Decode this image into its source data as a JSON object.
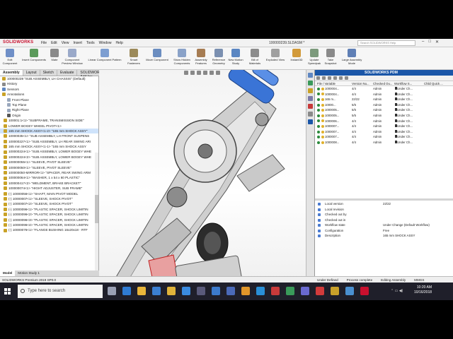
{
  "app": {
    "logo": "SOLIDWORKS",
    "doc_title": "100000239.SLDASM *",
    "search_placeholder": "Search SOLIDWORKS Help",
    "menus": [
      "File",
      "Edit",
      "View",
      "Insert",
      "Tools",
      "Window",
      "Help"
    ],
    "window_controls": [
      "–",
      "□",
      "✕"
    ]
  },
  "commands": [
    {
      "label": "Edit Component",
      "icon": "edit-component-icon",
      "color": "#6f8fc7"
    },
    {
      "label": "Insert Components",
      "icon": "insert-components-icon",
      "color": "#5b9a5b"
    },
    {
      "label": "Mate",
      "icon": "mate-icon",
      "color": "#8a8a8a"
    },
    {
      "label": "Component Preview Window",
      "icon": "preview-window-icon",
      "color": "#9aa9c9"
    },
    {
      "label": "Linear Component Pattern",
      "icon": "linear-pattern-icon",
      "color": "#7d9ed1"
    },
    {
      "label": "Smart Fasteners",
      "icon": "smart-fasteners-icon",
      "color": "#9c8a5a"
    },
    {
      "label": "Move Component",
      "icon": "move-component-icon",
      "color": "#6b8dc0"
    },
    {
      "label": "Show Hidden Components",
      "icon": "show-hidden-icon",
      "color": "#8aa2c8"
    },
    {
      "label": "Assembly Features",
      "icon": "assembly-features-icon",
      "color": "#a67c52"
    },
    {
      "label": "Reference Geometry",
      "icon": "reference-geometry-icon",
      "color": "#7a8fb0"
    },
    {
      "label": "New Motion Study",
      "icon": "motion-study-icon",
      "color": "#5a86c2"
    },
    {
      "label": "Bill of Materials",
      "icon": "bom-icon",
      "color": "#8b8b8b"
    },
    {
      "label": "Exploded View",
      "icon": "exploded-view-icon",
      "color": "#a0a0a0"
    },
    {
      "label": "Instant3D",
      "icon": "instant3d-icon",
      "color": "#d29a3a"
    },
    {
      "label": "Update Speedpak",
      "icon": "speedpak-icon",
      "color": "#7c9a7c"
    },
    {
      "label": "Take Snapshot",
      "icon": "snapshot-icon",
      "color": "#8a8a8a"
    },
    {
      "label": "Large Assembly Mode",
      "icon": "large-assembly-icon",
      "color": "#5f7fb5"
    }
  ],
  "tabs": [
    "Assembly",
    "Layout",
    "Sketch",
    "Evaluate",
    "SOLIDWORKS Add-Ins"
  ],
  "tree": [
    {
      "label": "100000239 \"SUB ASSEMBLY, LH CHASSIS\" (Default)",
      "color": "#c9a227"
    },
    {
      "label": "History",
      "color": "#8a8a8a"
    },
    {
      "label": "Sensors",
      "color": "#5f87c2"
    },
    {
      "label": "Annotations",
      "color": "#c9a227"
    },
    {
      "label": "Front Plane",
      "color": "#9aa8bd"
    },
    {
      "label": "Top Plane",
      "color": "#9aa8bd"
    },
    {
      "label": "Right Plane",
      "color": "#9aa8bd"
    },
    {
      "label": "Origin",
      "color": "#555555"
    },
    {
      "label": "100001:1<1> \"SUBFRAME, TRANSMISSION SIDE\"",
      "color": "#c9a227"
    },
    {
      "label": "LOWER BOGEY WHEEL PIVOT<1>",
      "color": "#c9a227"
    },
    {
      "label": "165 mm SHOCK ASSY<1-2> \"165 mm SHOCK ASSY\"",
      "color": "#c9a227",
      "selected": true
    },
    {
      "label": "10000035<1> \"SUB ASSEMBLY, LH FRONT SUSPENS",
      "color": "#c9a227"
    },
    {
      "label": "100000227<1> \"SUB ASSEMBLY, LH REAR SWING ARI",
      "color": "#c9a227"
    },
    {
      "label": "165 mm SHOCK ASSY<1-1> \"165 mm SHOCK ASSY",
      "color": "#c9a227"
    },
    {
      "label": "100000224<1> \"SUB ASSEMBLY, LOWER BOGEY WHE",
      "color": "#c9a227"
    },
    {
      "label": "100000224<2> \"SUB ASSEMBLY, LOWER BOGEY WHE",
      "color": "#c9a227"
    },
    {
      "label": "100000055<1> \"SLEEVE, PIVOT SLEEVE\"",
      "color": "#c9a227"
    },
    {
      "label": "100000050<1> \"SLEEVE, PIVOT SLEEVE\"",
      "color": "#c9a227"
    },
    {
      "label": "100000050-MIRROR<1> \"SPACER, REAR SWING ARM",
      "color": "#c9a227"
    },
    {
      "label": "100000064<1> \"WASHER, 1 x 54 x 60 PLASTIC\"",
      "color": "#c9a227"
    },
    {
      "label": "100000417<2> \"WELDMENT, BRAKE BRACKET\"",
      "color": "#c9a227"
    },
    {
      "label": "100000074<1> \"HIGHT ADJUSTER, SUB FRAME\"",
      "color": "#c9a227"
    },
    {
      "label": "(-) 10000056<1> \"SHAFT, MAIN PIVOT MODEL",
      "color": "#c9a227"
    },
    {
      "label": "(-) 10000007<1> \"SLEEVE, SHOCK PIVOT\"",
      "color": "#c9a227"
    },
    {
      "label": "(-) 10000007<2> \"SLEEVE, SHOCK PIVOT\"",
      "color": "#c9a227"
    },
    {
      "label": "(-) 10000096<1> \"PLASTIC SPACER, SHOCK LIMITIN",
      "color": "#c9a227"
    },
    {
      "label": "(-) 10000096<2> \"PLASTIC SPACER, SHOCK LIMITIN",
      "color": "#c9a227"
    },
    {
      "label": "(-) 10000096<3> \"PLASTIC SPACER, SHOCK LIMITIN",
      "color": "#c9a227"
    },
    {
      "label": "(-) 10000096<4> \"PLASTIC SPACER, SHOCK LIMITIN",
      "color": "#c9a227"
    },
    {
      "label": "(-) 10000076<1> \"FLANGE BUSHING 16x20x18 - RTF",
      "color": "#c9a227"
    }
  ],
  "bottom_tabs": [
    "Model",
    "Motion Study 1"
  ],
  "status": {
    "left": "SOLIDWORKS Premium 2019 SP0.0",
    "items": [
      "Under Defined",
      "Process complete",
      "Editing Assembly",
      "MMGS"
    ]
  },
  "pdm": {
    "title": "SOLIDWORKS PDM",
    "columns": [
      "File / Variable",
      "Version Nu...",
      "Checked Ou...",
      "Workflow S...",
      "Child Quick ..."
    ],
    "rows": [
      {
        "file": "1000004...",
        "version": "4/4",
        "checked": "Admin",
        "workflow": "Under Ch..."
      },
      {
        "file": "1000004...",
        "version": "4/4",
        "checked": "Admin",
        "workflow": "Under Ch..."
      },
      {
        "file": "165 m...",
        "version": "22/22",
        "checked": "Admin",
        "workflow": "Under Ch..."
      },
      {
        "file": "10000...",
        "version": "5/5",
        "checked": "Admin",
        "workflow": "Under Ch..."
      },
      {
        "file": "1000005...",
        "version": "5/5",
        "checked": "Admin",
        "workflow": "Under Ch..."
      },
      {
        "file": "1000005...",
        "version": "5/5",
        "checked": "Admin",
        "workflow": "Under Ch..."
      },
      {
        "file": "1000006...",
        "version": "4/4",
        "checked": "Admin",
        "workflow": "Under Ch..."
      },
      {
        "file": "1000007...",
        "version": "4/4",
        "checked": "Admin",
        "workflow": "Under Ch..."
      },
      {
        "file": "1000007...",
        "version": "4/4",
        "checked": "Admin",
        "workflow": "Under Ch..."
      },
      {
        "file": "1000007...",
        "version": "4/4",
        "checked": "Admin",
        "workflow": "Under Ch..."
      },
      {
        "file": "1000008...",
        "version": "4/4",
        "checked": "Admin",
        "workflow": "Under Ch..."
      }
    ],
    "details": [
      {
        "key": "Local version",
        "value": "22/22"
      },
      {
        "key": "Local revision",
        "value": ""
      },
      {
        "key": "Checked out by",
        "value": ""
      },
      {
        "key": "Checked out in",
        "value": ""
      },
      {
        "key": "Workflow state",
        "value": "Under Change (Default Workflow)"
      },
      {
        "key": "Configuration",
        "value": "Free"
      },
      {
        "key": "Description",
        "value": "165 mm SHOCK ASSY"
      }
    ]
  },
  "taskbar": {
    "search_placeholder": "Type here to search",
    "time": "10:20 AM",
    "date": "10/16/2018",
    "icons": [
      {
        "name": "task-view-icon",
        "color": "#9aa0b4"
      },
      {
        "name": "edge-icon",
        "color": "#2f7bd2"
      },
      {
        "name": "file-explorer-icon",
        "color": "#e8b53a"
      },
      {
        "name": "store-icon",
        "color": "#3b7fd1"
      },
      {
        "name": "chrome-icon",
        "color": "#e0b33a"
      },
      {
        "name": "ie-icon",
        "color": "#3a8be0"
      },
      {
        "name": "app-icon-1",
        "color": "#5a5a7a"
      },
      {
        "name": "app-icon-2",
        "color": "#3c7acb"
      },
      {
        "name": "app-icon-3",
        "color": "#4b6ab8"
      },
      {
        "name": "app-icon-4",
        "color": "#e0962a"
      },
      {
        "name": "app-icon-5",
        "color": "#2a8fd6"
      },
      {
        "name": "app-icon-6",
        "color": "#c83a3a"
      },
      {
        "name": "app-icon-7",
        "color": "#3a9a5a"
      },
      {
        "name": "app-icon-8",
        "color": "#6a6ad0"
      },
      {
        "name": "app-icon-9",
        "color": "#d23b3b"
      },
      {
        "name": "app-icon-10",
        "color": "#c8a02a"
      },
      {
        "name": "app-icon-11",
        "color": "#4a90d0"
      },
      {
        "name": "solidworks-task-icon",
        "color": "#c8102e"
      }
    ]
  }
}
